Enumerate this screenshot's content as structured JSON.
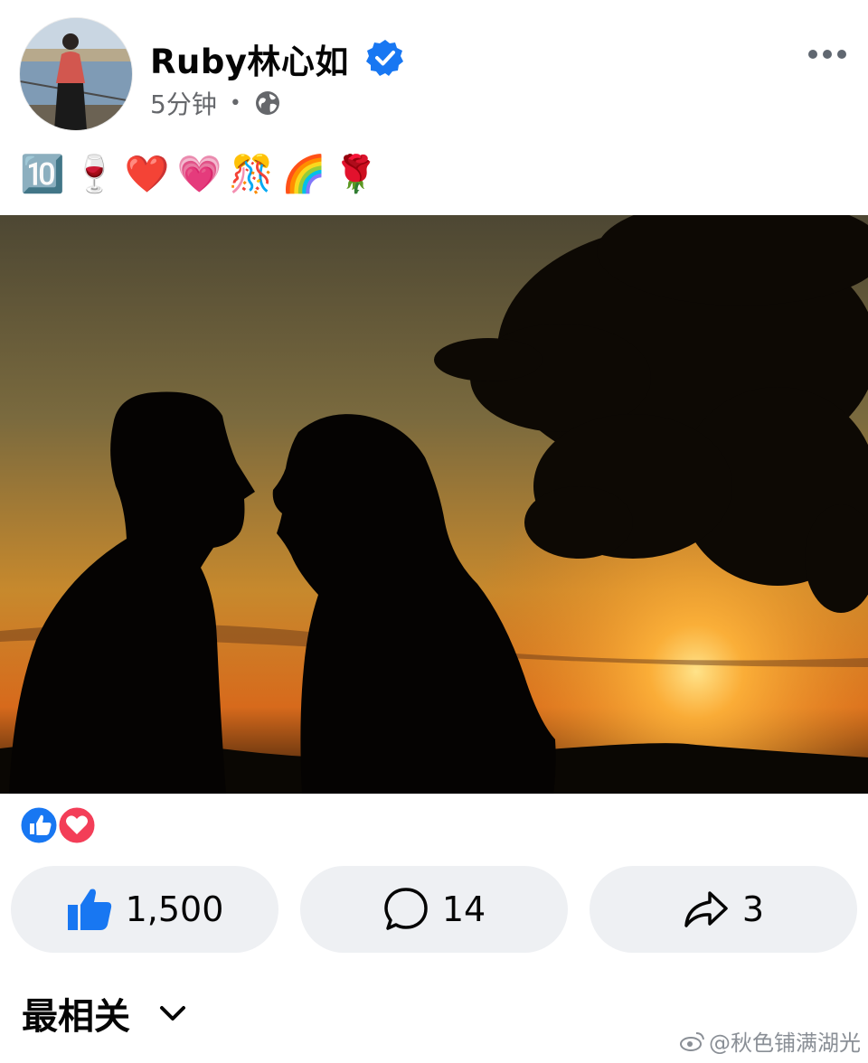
{
  "post": {
    "author": "Ruby林心如",
    "time": "5分钟",
    "separator": "•",
    "privacy_icon": "globe-icon",
    "verified_icon": "verified-badge-icon",
    "caption_emojis": [
      "🔟",
      "🍷",
      "❤️",
      "💗",
      "🎊",
      "🌈",
      "🌹"
    ]
  },
  "reactions": {
    "icons": [
      "like-reaction-icon",
      "love-reaction-icon"
    ]
  },
  "actions": {
    "like_count": "1,500",
    "comment_count": "14",
    "share_count": "3"
  },
  "comments": {
    "sort_label": "最相关"
  },
  "watermark": {
    "text": "@秋色铺满湖光"
  },
  "colors": {
    "verified_blue": "#1877f2",
    "like_blue": "#1877f2",
    "love_red": "#f33e58",
    "action_bg": "#eef0f3",
    "secondary_text": "#65676b"
  }
}
